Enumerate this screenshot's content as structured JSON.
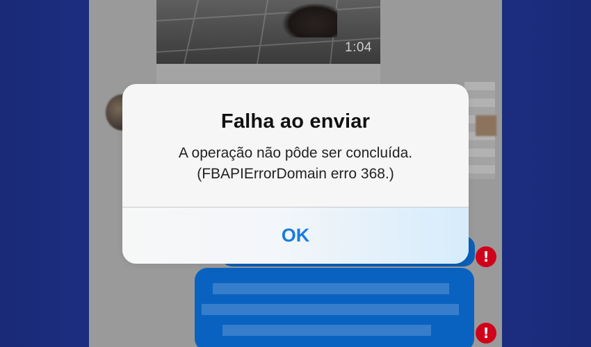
{
  "video": {
    "duration": "1:04"
  },
  "alert": {
    "title": "Falha ao enviar",
    "message_line1": "A operação não pôde ser concluída.",
    "message_line2": "(FBAPIErrorDomain erro 368.)",
    "button_label": "OK"
  },
  "status": {
    "error_icon": "!",
    "error_color": "#d0021b"
  },
  "colors": {
    "accent": "#1a7be0",
    "bubble": "#0a62c0",
    "background": "#1c2d80"
  }
}
